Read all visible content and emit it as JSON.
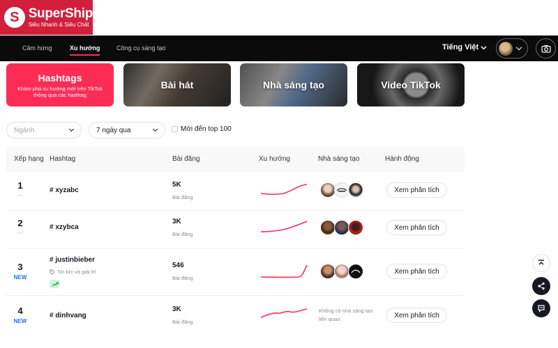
{
  "brand": {
    "name": "SuperShip",
    "tagline": "Siêu Nhanh & Siêu Chất",
    "mark": "S",
    "color": "#d21f3c"
  },
  "nav": {
    "links": [
      "Cảm hứng",
      "Xu hướng",
      "Công cụ sáng tạo"
    ],
    "active": "Xu hướng",
    "language": "Tiếng Việt"
  },
  "categories": {
    "hashtags": {
      "title": "Hashtags",
      "subtitle": "Khám phá xu hướng mới trên TikTok thông qua các hashtag"
    },
    "songs": "Bài hát",
    "creators": "Nhà sáng tạo",
    "videos": "Video TikTok"
  },
  "filters": {
    "industry_placeholder": "Ngành",
    "period": "7 ngày qua",
    "top100_label": "Mới đến top 100"
  },
  "table": {
    "headers": [
      "Xếp hạng",
      "Hashtag",
      "Bài đăng",
      "Xu hướng",
      "Nhà sáng tạo",
      "Hành động"
    ],
    "rows": [
      {
        "rank": "1",
        "rank_note": "—",
        "hashtag": "# xyzabc",
        "posts": "5K",
        "posts_label": "Bài đăng",
        "action": "Xem phân tích"
      },
      {
        "rank": "2",
        "rank_note": "—",
        "hashtag": "# xzybca",
        "posts": "3K",
        "posts_label": "Bài đăng",
        "action": "Xem phân tích"
      },
      {
        "rank": "3",
        "rank_note": "NEW",
        "hashtag": "# justinbieber",
        "category": "Tin tức và giải trí",
        "posts": "546",
        "posts_label": "Bài đăng",
        "action": "Xem phân tích"
      },
      {
        "rank": "4",
        "rank_note": "NEW",
        "hashtag": "# dinhvang",
        "posts": "3K",
        "posts_label": "Bài đăng",
        "no_creator": "Không có nhà sáng tạo liên quan",
        "action": "Xem phân tích"
      }
    ]
  },
  "colors": {
    "accent": "#fe2c55",
    "new_badge": "#1e74d6",
    "trend_up": "#d4f5dd"
  },
  "icons": [
    "chevron-down-icon",
    "camera-icon",
    "tag-icon",
    "trending-up-icon",
    "scroll-top-icon",
    "share-icon",
    "chat-icon"
  ]
}
